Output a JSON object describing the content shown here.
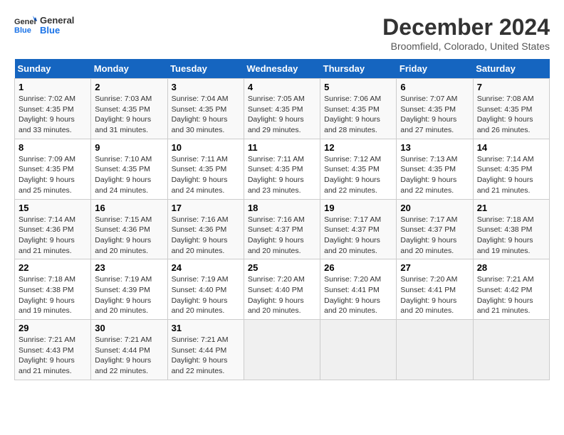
{
  "header": {
    "logo_line1": "General",
    "logo_line2": "Blue",
    "month_title": "December 2024",
    "location": "Broomfield, Colorado, United States"
  },
  "weekdays": [
    "Sunday",
    "Monday",
    "Tuesday",
    "Wednesday",
    "Thursday",
    "Friday",
    "Saturday"
  ],
  "weeks": [
    [
      {
        "day": "1",
        "sunrise": "Sunrise: 7:02 AM",
        "sunset": "Sunset: 4:35 PM",
        "daylight": "Daylight: 9 hours and 33 minutes."
      },
      {
        "day": "2",
        "sunrise": "Sunrise: 7:03 AM",
        "sunset": "Sunset: 4:35 PM",
        "daylight": "Daylight: 9 hours and 31 minutes."
      },
      {
        "day": "3",
        "sunrise": "Sunrise: 7:04 AM",
        "sunset": "Sunset: 4:35 PM",
        "daylight": "Daylight: 9 hours and 30 minutes."
      },
      {
        "day": "4",
        "sunrise": "Sunrise: 7:05 AM",
        "sunset": "Sunset: 4:35 PM",
        "daylight": "Daylight: 9 hours and 29 minutes."
      },
      {
        "day": "5",
        "sunrise": "Sunrise: 7:06 AM",
        "sunset": "Sunset: 4:35 PM",
        "daylight": "Daylight: 9 hours and 28 minutes."
      },
      {
        "day": "6",
        "sunrise": "Sunrise: 7:07 AM",
        "sunset": "Sunset: 4:35 PM",
        "daylight": "Daylight: 9 hours and 27 minutes."
      },
      {
        "day": "7",
        "sunrise": "Sunrise: 7:08 AM",
        "sunset": "Sunset: 4:35 PM",
        "daylight": "Daylight: 9 hours and 26 minutes."
      }
    ],
    [
      {
        "day": "8",
        "sunrise": "Sunrise: 7:09 AM",
        "sunset": "Sunset: 4:35 PM",
        "daylight": "Daylight: 9 hours and 25 minutes."
      },
      {
        "day": "9",
        "sunrise": "Sunrise: 7:10 AM",
        "sunset": "Sunset: 4:35 PM",
        "daylight": "Daylight: 9 hours and 24 minutes."
      },
      {
        "day": "10",
        "sunrise": "Sunrise: 7:11 AM",
        "sunset": "Sunset: 4:35 PM",
        "daylight": "Daylight: 9 hours and 24 minutes."
      },
      {
        "day": "11",
        "sunrise": "Sunrise: 7:11 AM",
        "sunset": "Sunset: 4:35 PM",
        "daylight": "Daylight: 9 hours and 23 minutes."
      },
      {
        "day": "12",
        "sunrise": "Sunrise: 7:12 AM",
        "sunset": "Sunset: 4:35 PM",
        "daylight": "Daylight: 9 hours and 22 minutes."
      },
      {
        "day": "13",
        "sunrise": "Sunrise: 7:13 AM",
        "sunset": "Sunset: 4:35 PM",
        "daylight": "Daylight: 9 hours and 22 minutes."
      },
      {
        "day": "14",
        "sunrise": "Sunrise: 7:14 AM",
        "sunset": "Sunset: 4:35 PM",
        "daylight": "Daylight: 9 hours and 21 minutes."
      }
    ],
    [
      {
        "day": "15",
        "sunrise": "Sunrise: 7:14 AM",
        "sunset": "Sunset: 4:36 PM",
        "daylight": "Daylight: 9 hours and 21 minutes."
      },
      {
        "day": "16",
        "sunrise": "Sunrise: 7:15 AM",
        "sunset": "Sunset: 4:36 PM",
        "daylight": "Daylight: 9 hours and 20 minutes."
      },
      {
        "day": "17",
        "sunrise": "Sunrise: 7:16 AM",
        "sunset": "Sunset: 4:36 PM",
        "daylight": "Daylight: 9 hours and 20 minutes."
      },
      {
        "day": "18",
        "sunrise": "Sunrise: 7:16 AM",
        "sunset": "Sunset: 4:37 PM",
        "daylight": "Daylight: 9 hours and 20 minutes."
      },
      {
        "day": "19",
        "sunrise": "Sunrise: 7:17 AM",
        "sunset": "Sunset: 4:37 PM",
        "daylight": "Daylight: 9 hours and 20 minutes."
      },
      {
        "day": "20",
        "sunrise": "Sunrise: 7:17 AM",
        "sunset": "Sunset: 4:37 PM",
        "daylight": "Daylight: 9 hours and 20 minutes."
      },
      {
        "day": "21",
        "sunrise": "Sunrise: 7:18 AM",
        "sunset": "Sunset: 4:38 PM",
        "daylight": "Daylight: 9 hours and 19 minutes."
      }
    ],
    [
      {
        "day": "22",
        "sunrise": "Sunrise: 7:18 AM",
        "sunset": "Sunset: 4:38 PM",
        "daylight": "Daylight: 9 hours and 19 minutes."
      },
      {
        "day": "23",
        "sunrise": "Sunrise: 7:19 AM",
        "sunset": "Sunset: 4:39 PM",
        "daylight": "Daylight: 9 hours and 20 minutes."
      },
      {
        "day": "24",
        "sunrise": "Sunrise: 7:19 AM",
        "sunset": "Sunset: 4:40 PM",
        "daylight": "Daylight: 9 hours and 20 minutes."
      },
      {
        "day": "25",
        "sunrise": "Sunrise: 7:20 AM",
        "sunset": "Sunset: 4:40 PM",
        "daylight": "Daylight: 9 hours and 20 minutes."
      },
      {
        "day": "26",
        "sunrise": "Sunrise: 7:20 AM",
        "sunset": "Sunset: 4:41 PM",
        "daylight": "Daylight: 9 hours and 20 minutes."
      },
      {
        "day": "27",
        "sunrise": "Sunrise: 7:20 AM",
        "sunset": "Sunset: 4:41 PM",
        "daylight": "Daylight: 9 hours and 20 minutes."
      },
      {
        "day": "28",
        "sunrise": "Sunrise: 7:21 AM",
        "sunset": "Sunset: 4:42 PM",
        "daylight": "Daylight: 9 hours and 21 minutes."
      }
    ],
    [
      {
        "day": "29",
        "sunrise": "Sunrise: 7:21 AM",
        "sunset": "Sunset: 4:43 PM",
        "daylight": "Daylight: 9 hours and 21 minutes."
      },
      {
        "day": "30",
        "sunrise": "Sunrise: 7:21 AM",
        "sunset": "Sunset: 4:44 PM",
        "daylight": "Daylight: 9 hours and 22 minutes."
      },
      {
        "day": "31",
        "sunrise": "Sunrise: 7:21 AM",
        "sunset": "Sunset: 4:44 PM",
        "daylight": "Daylight: 9 hours and 22 minutes."
      },
      null,
      null,
      null,
      null
    ]
  ]
}
